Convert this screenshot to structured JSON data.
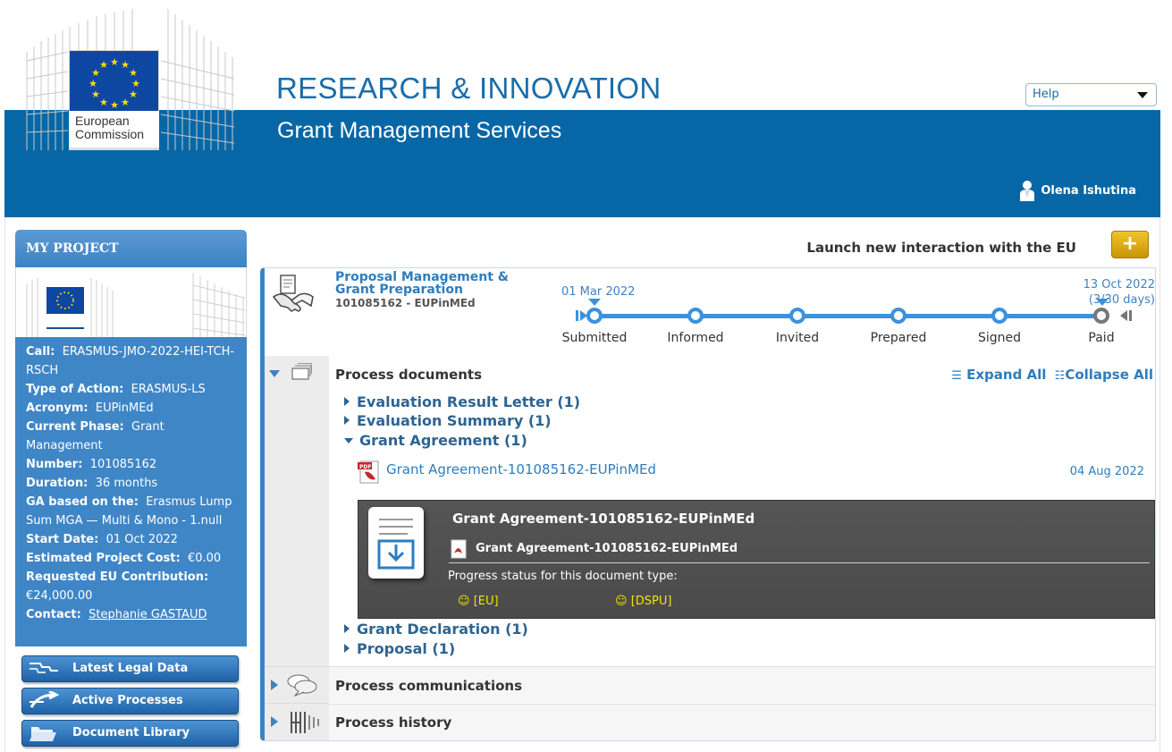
{
  "header": {
    "org_caption_line1": "European",
    "org_caption_line2": "Commission",
    "site_title": "RESEARCH & INNOVATION",
    "site_subtitle": "Grant Management Services",
    "help_select": "Help",
    "user_name": "Olena Ishutina"
  },
  "sidebar": {
    "title": "MY PROJECT",
    "fields": [
      {
        "label": "Call:",
        "value": "ERASMUS-JMO-2022-HEI-TCH-RSCH"
      },
      {
        "label": "Type of Action:",
        "value": "ERASMUS-LS"
      },
      {
        "label": "Acronym:",
        "value": "EUPinMEd"
      },
      {
        "label": "Current Phase:",
        "value": "Grant Management"
      },
      {
        "label": "Number:",
        "value": "101085162"
      },
      {
        "label": "Duration:",
        "value": "36 months"
      },
      {
        "label": "GA based on the:",
        "value": "Erasmus Lump Sum MGA — Multi & Mono - 1.null"
      },
      {
        "label": "Start Date:",
        "value": "01 Oct 2022"
      },
      {
        "label": "Estimated Project Cost:",
        "value": "€0.00"
      },
      {
        "label": "Requested EU Contribution:",
        "value": "€24,000.00"
      },
      {
        "label": "Contact:",
        "value": "Stephanie GASTAUD"
      }
    ],
    "buttons": [
      "Latest Legal Data",
      "Active Processes",
      "Document Library"
    ]
  },
  "main": {
    "launch_text": "Launch new interaction with the EU",
    "launch_button": "+",
    "process": {
      "title": "Proposal Management & Grant Preparation",
      "code": "101085162 - EUPinMEd",
      "start_date": "01 Mar 2022",
      "end_date": "13 Oct 2022",
      "end_days": "(3/30 days)",
      "steps": [
        "Submitted",
        "Informed",
        "Invited",
        "Prepared",
        "Signed",
        "Paid"
      ]
    },
    "documents": {
      "title": "Process documents",
      "expand_all": "Expand All",
      "collapse_all": "Collapse All",
      "items": [
        "Evaluation Result Letter (1)",
        "Evaluation Summary (1)",
        "Grant Agreement (1)",
        "Grant Declaration (1)",
        "Proposal (1)"
      ],
      "ga_file": "Grant Agreement-101085162-EUPinMEd",
      "ga_date": "04 Aug 2022",
      "card_title": "Grant Agreement-101085162-EUPinMEd",
      "card_file": "Grant Agreement-101085162-EUPinMEd",
      "card_status_label": "Progress status for this document type:",
      "card_parties": [
        "[EU]",
        "[DSPU]"
      ]
    },
    "communications_title": "Process communications",
    "history_title": "Process history"
  },
  "colors": {
    "brand_blue": "#0767a6",
    "accent_blue": "#3d83c4",
    "launch_yellow": "#e2b118",
    "status_yellow": "#f2e200"
  }
}
